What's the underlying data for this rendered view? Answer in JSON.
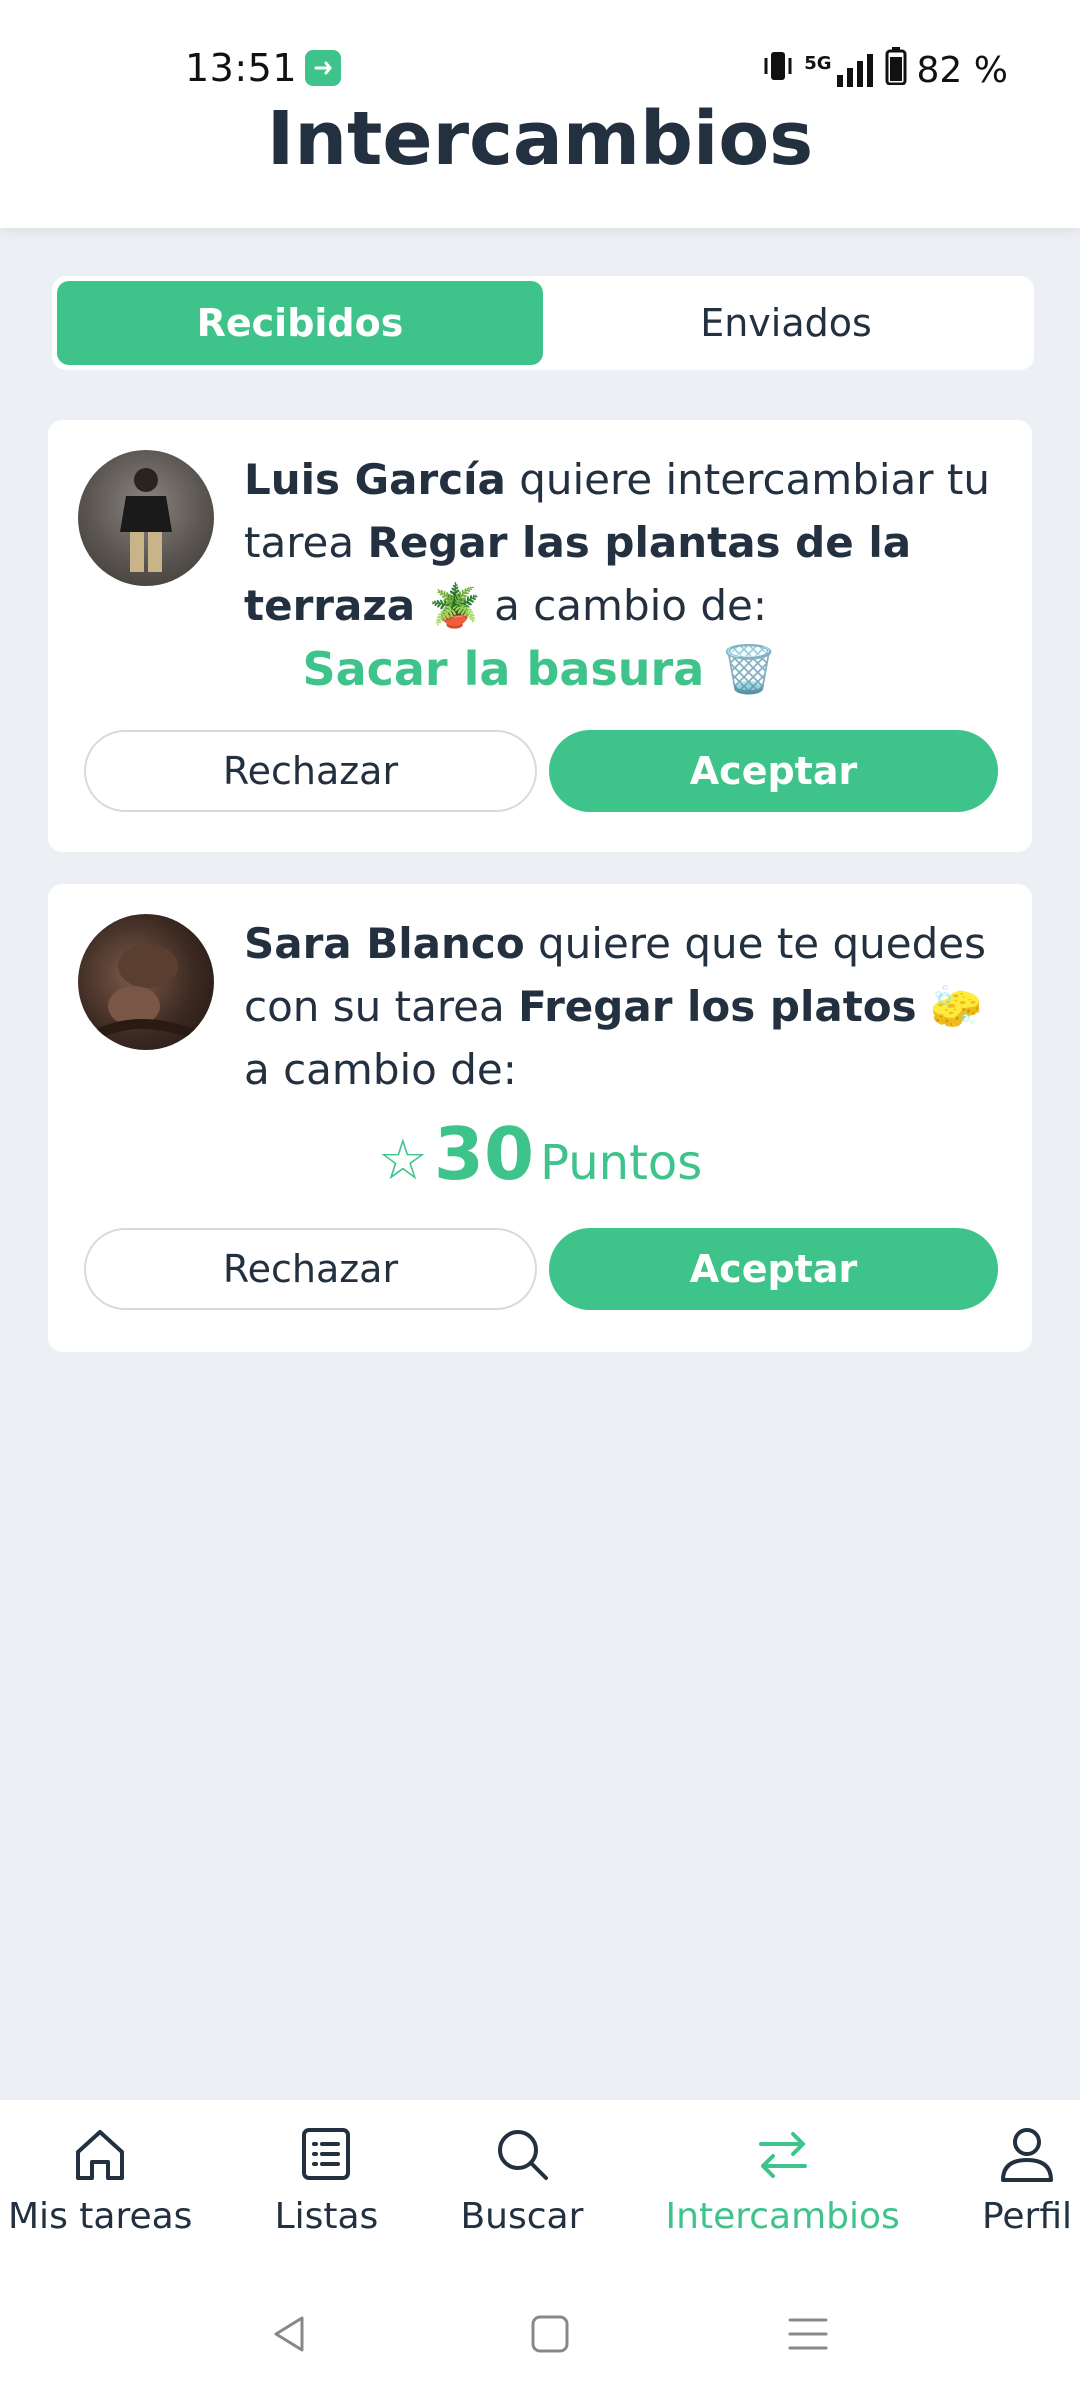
{
  "status_bar": {
    "time": "13:51",
    "network": "5G",
    "battery": "82 %"
  },
  "header": {
    "title": "Intercambios"
  },
  "tabs": [
    {
      "label": "Recibidos",
      "active": true
    },
    {
      "label": "Enviados",
      "active": false
    }
  ],
  "requests": [
    {
      "user": "Luis García",
      "text_1": " quiere intercambiar tu tarea ",
      "task": "Regar las plantas de la terraza",
      "task_emoji": "🪴",
      "text_2": " a cambio de:",
      "offer_task": "Sacar la basura",
      "offer_emoji": "🗑️",
      "reject_label": "Rechazar",
      "accept_label": "Aceptar"
    },
    {
      "user": "Sara Blanco",
      "text_1": " quiere que te quedes con su tarea ",
      "task": "Fregar los platos",
      "task_emoji": "🧽",
      "text_2": " a cambio de:",
      "offer_points": "30",
      "offer_points_unit": "Puntos",
      "reject_label": "Rechazar",
      "accept_label": "Aceptar"
    }
  ],
  "bottom_nav": [
    {
      "label": "Mis tareas",
      "icon": "home-icon",
      "active": false
    },
    {
      "label": "Listas",
      "icon": "list-icon",
      "active": false
    },
    {
      "label": "Buscar",
      "icon": "search-icon",
      "active": false
    },
    {
      "label": "Intercambios",
      "icon": "swap-icon",
      "active": true
    },
    {
      "label": "Perfil",
      "icon": "user-icon",
      "active": false
    }
  ],
  "colors": {
    "accent": "#3ec48a",
    "text": "#22303f",
    "background": "#ecf0f4"
  }
}
